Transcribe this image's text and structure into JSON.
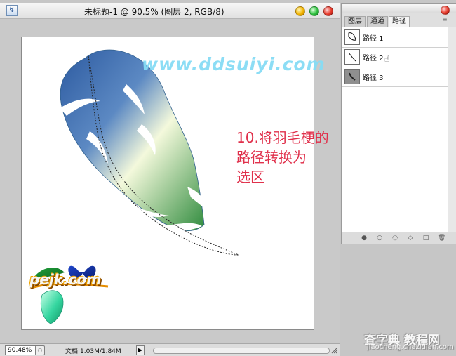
{
  "document_window": {
    "title": "未标题-1 @ 90.5% (图层 2, RGB/8)",
    "zoom": "90.48%",
    "doc_info": "文档:1.03M/1.84M",
    "canvas_watermark": "www.ddsuiyi.com",
    "annotation_lines": [
      "10.将羽毛梗的路径转换为",
      "选区"
    ],
    "logo_text": "pejk.com"
  },
  "panel": {
    "tabs": [
      {
        "label": "图层",
        "active": false
      },
      {
        "label": "通道",
        "active": false
      },
      {
        "label": "路径",
        "active": true
      }
    ],
    "paths": [
      {
        "label": "路径 1",
        "thumb": "feather-outline"
      },
      {
        "label": "路径 2",
        "thumb": "stem-line"
      },
      {
        "label": "路径 3",
        "thumb": "dark-stroke"
      }
    ]
  },
  "site_stamp": {
    "main": "查字典 教程网",
    "sub": "jiaocheng.chazidian.com"
  },
  "colors": {
    "feather_top": "#2c5aa0",
    "feather_mid": "#f4f9dc",
    "feather_bottom": "#2f8b3d",
    "annotation": "#e0304b",
    "watermark": "#86dcf5"
  }
}
